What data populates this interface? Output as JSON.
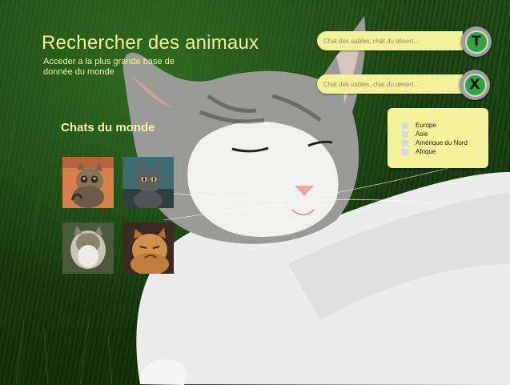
{
  "header": {
    "title": "Rechercher des animaux",
    "subtitle": "Acceder a la plus grande base de donnée du monde"
  },
  "section": {
    "title": "Chats du monde"
  },
  "gallery": {
    "items": [
      {
        "name": "cat-photo-tabby-looking-up"
      },
      {
        "name": "cat-photo-grey"
      },
      {
        "name": "cat-photo-longhair"
      },
      {
        "name": "cat-photo-orange-grumpy"
      }
    ]
  },
  "search_top": {
    "placeholder": "Chat des sables, chat du desert...",
    "button_label": "T"
  },
  "search_bottom": {
    "placeholder": "Chat des sables, chat du desert...",
    "button_label": "X"
  },
  "regions": {
    "items": [
      {
        "label": "Europe"
      },
      {
        "label": "Asie"
      },
      {
        "label": "Amérique du Nord"
      },
      {
        "label": "Afrique"
      }
    ]
  },
  "colors": {
    "accent_yellow": "#f3f29a",
    "button_green": "#2fa53a",
    "button_ring": "#9e9e9e"
  }
}
